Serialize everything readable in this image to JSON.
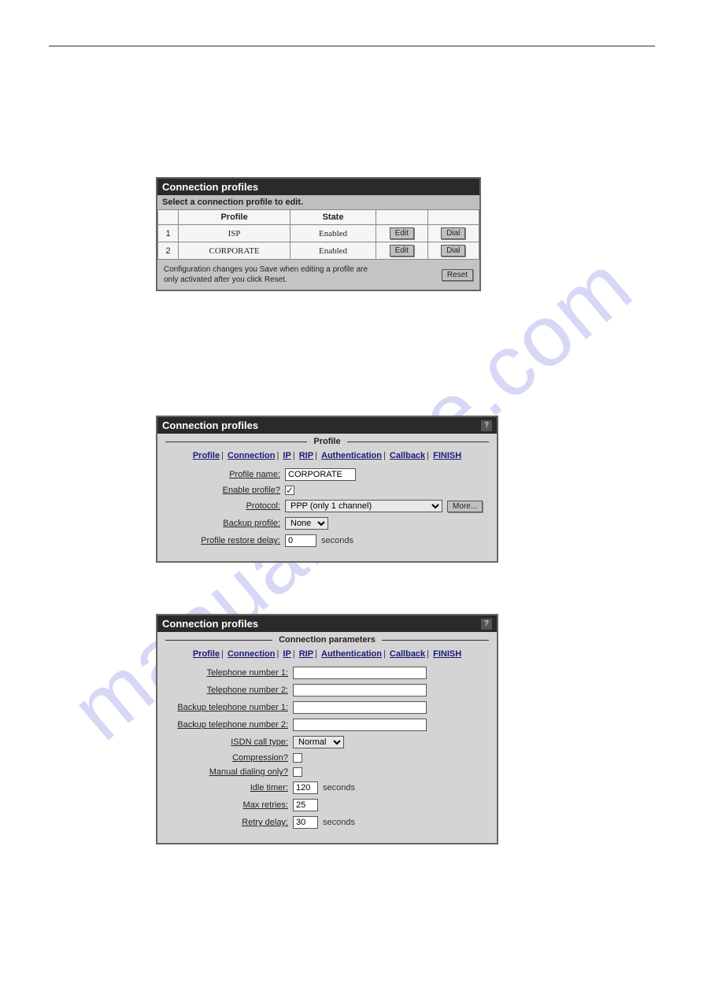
{
  "watermark": "manualshive.com",
  "panel1": {
    "title": "Connection profiles",
    "instruction": "Select a connection profile to edit.",
    "headers": {
      "col1": "",
      "profile": "Profile",
      "state": "State"
    },
    "rows": [
      {
        "idx": "1",
        "profile": "ISP",
        "state": "Enabled",
        "edit": "Edit",
        "dial": "Dial"
      },
      {
        "idx": "2",
        "profile": "CORPORATE",
        "state": "Enabled",
        "edit": "Edit",
        "dial": "Dial"
      }
    ],
    "footer_text": "Configuration changes you Save when editing a profile are only activated after you click Reset.",
    "reset": "Reset"
  },
  "panel2": {
    "title": "Connection profiles",
    "help": "?",
    "section": "Profile",
    "nav": [
      "Profile",
      "Connection",
      "IP",
      "RIP",
      "Authentication",
      "Callback",
      "FINISH"
    ],
    "profile_name_label": "Profile name:",
    "profile_name_value": "CORPORATE",
    "enable_label": "Enable profile?",
    "enable_checked": "✓",
    "protocol_label": "Protocol:",
    "protocol_value": "PPP (only 1 channel)",
    "more": "More...",
    "backup_label": "Backup profile:",
    "backup_value": "None",
    "restore_label": "Profile restore delay:",
    "restore_value": "0",
    "restore_suffix": "seconds"
  },
  "panel3": {
    "title": "Connection profiles",
    "help": "?",
    "section": "Connection parameters",
    "nav": [
      "Profile",
      "Connection",
      "IP",
      "RIP",
      "Authentication",
      "Callback",
      "FINISH"
    ],
    "tel1_label": "Telephone number 1:",
    "tel1_value": "",
    "tel2_label": "Telephone number 2:",
    "tel2_value": "",
    "btel1_label": "Backup telephone number 1:",
    "btel1_value": "",
    "btel2_label": "Backup telephone number 2:",
    "btel2_value": "",
    "isdn_label": "ISDN call type:",
    "isdn_value": "Normal",
    "compression_label": "Compression?",
    "manual_label": "Manual dialing only?",
    "idle_label": "Idle timer:",
    "idle_value": "120",
    "idle_suffix": "seconds",
    "maxretries_label": "Max retries:",
    "maxretries_value": "25",
    "retrydelay_label": "Retry delay:",
    "retrydelay_value": "30",
    "retrydelay_suffix": "seconds"
  }
}
